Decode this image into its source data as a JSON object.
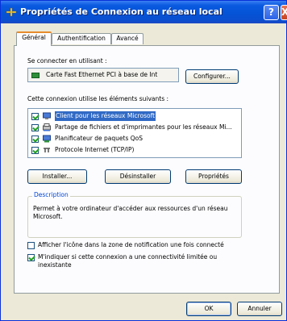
{
  "window": {
    "title": "Propriétés de Connexion au réseau local",
    "help_glyph": "?",
    "close_glyph": "X"
  },
  "tabs": [
    {
      "label": "Général",
      "active": true
    },
    {
      "label": "Authentification",
      "active": false
    },
    {
      "label": "Avancé",
      "active": false
    }
  ],
  "connect_using": {
    "label": "Se connecter en utilisant :",
    "adapter": "Carte Fast Ethernet PCI à base de Int",
    "configure_button": "Configurer..."
  },
  "components": {
    "label": "Cette connexion utilise les éléments suivants :",
    "items": [
      {
        "label": "Client pour les réseaux Microsoft",
        "checked": true,
        "selected": true,
        "icon": "network-client-icon"
      },
      {
        "label": "Partage de fichiers et d'imprimantes pour les réseaux Mi...",
        "checked": true,
        "selected": false,
        "icon": "file-printer-sharing-icon"
      },
      {
        "label": "Planificateur de paquets QoS",
        "checked": true,
        "selected": false,
        "icon": "qos-scheduler-icon"
      },
      {
        "label": "Protocole Internet (TCP/IP)",
        "checked": true,
        "selected": false,
        "icon": "protocol-icon"
      }
    ],
    "install_button": "Installer...",
    "uninstall_button": "Désinstaller",
    "properties_button": "Propriétés"
  },
  "description": {
    "legend": "Description",
    "text": "Permet à votre ordinateur d'accéder aux ressources d'un réseau Microsoft."
  },
  "options": {
    "show_icon": {
      "label": "Afficher l'icône dans la zone de notification une fois connecté",
      "checked": false
    },
    "notify_limited": {
      "label": "M'indiquer si cette connexion a une connectivité limitée ou inexistante",
      "checked": true
    }
  },
  "footer": {
    "ok_button": "OK",
    "cancel_button": "Annuler"
  }
}
